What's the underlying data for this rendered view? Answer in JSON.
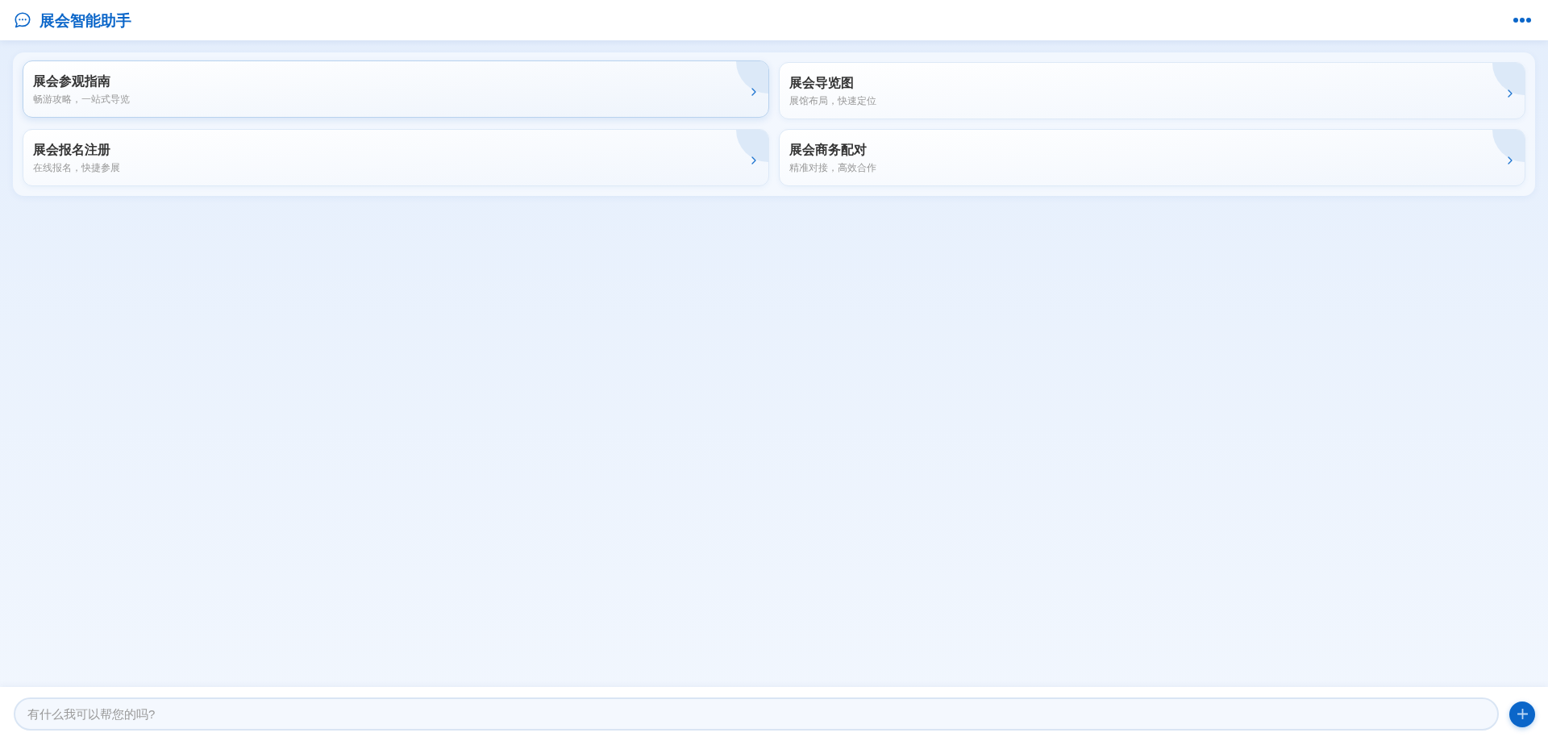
{
  "header": {
    "title": "展会智能助手"
  },
  "cards": [
    {
      "title": "展会参观指南",
      "subtitle": "畅游攻略，一站式导览",
      "highlighted": true
    },
    {
      "title": "展会导览图",
      "subtitle": "展馆布局，快速定位",
      "highlighted": false
    },
    {
      "title": "展会报名注册",
      "subtitle": "在线报名，快捷参展",
      "highlighted": false
    },
    {
      "title": "展会商务配对",
      "subtitle": "精准对接，高效合作",
      "highlighted": false
    }
  ],
  "composer": {
    "placeholder": "有什么我可以帮您的吗?"
  }
}
